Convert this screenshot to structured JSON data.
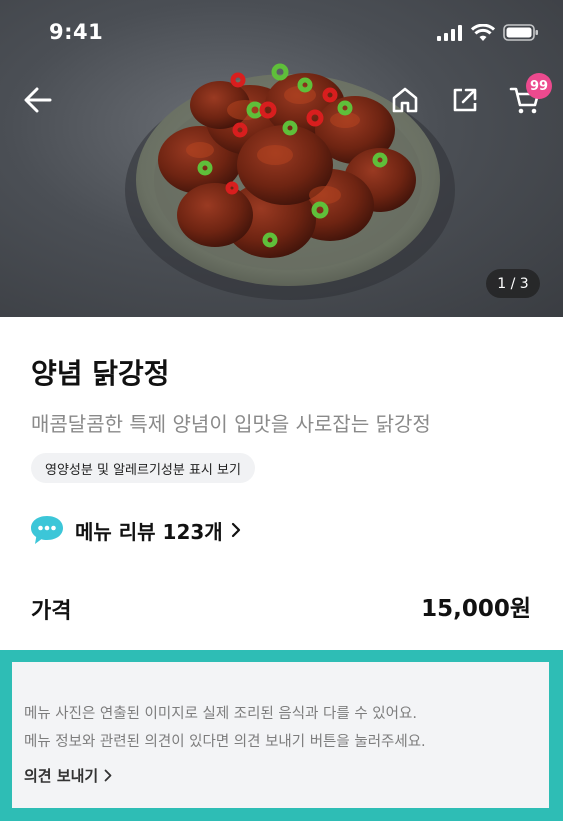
{
  "status_bar": {
    "time": "9:41"
  },
  "header": {
    "cart_count": "99"
  },
  "gallery": {
    "counter": "1 / 3"
  },
  "product": {
    "title": "양념 닭강정",
    "description": "매콤달콤한 특제 양념이 입맛을 사로잡는 닭강정",
    "nutrition_label": "영양성분 및 알레르기성분 표시 보기"
  },
  "review": {
    "label": "메뉴 리뷰 123개"
  },
  "price": {
    "label": "가격",
    "value": "15,000원"
  },
  "notice": {
    "line1": "메뉴 사진은 연출된 이미지로 실제 조리된 음식과 다를 수 있어요.",
    "line2": "메뉴 정보와 관련된 의견이 있다면 의견 보내기 버튼을 눌러주세요.",
    "feedback_label": "의견 보내기"
  },
  "icons": {
    "back": "arrow-left-icon",
    "home": "home-icon",
    "share": "share-icon",
    "cart": "cart-icon",
    "review": "speech-bubble-icon",
    "chevron": "chevron-right-icon"
  },
  "colors": {
    "accent_teal": "#2ebdb5",
    "badge_pink": "#ec4a8e",
    "review_icon": "#3cc6d8"
  }
}
